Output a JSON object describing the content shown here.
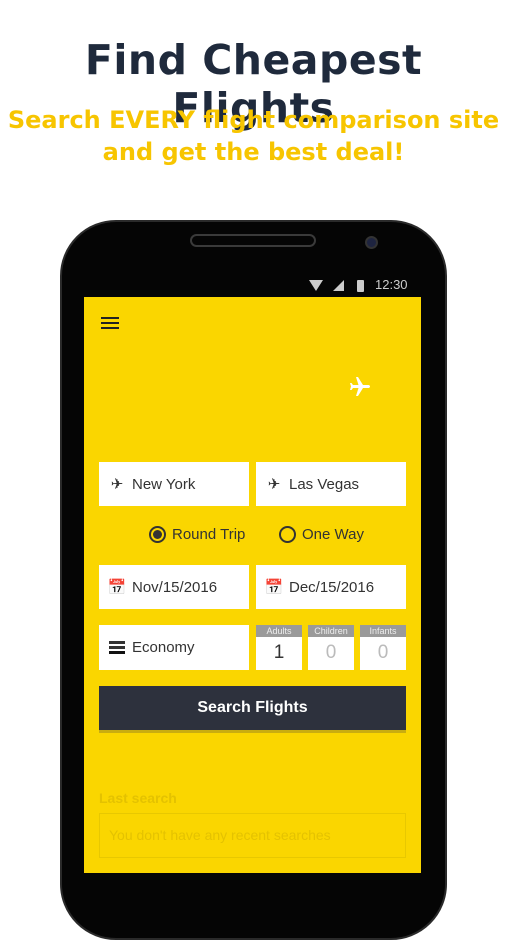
{
  "headline": "Find Cheapest Flights",
  "subline1": "Search EVERY flight comparison site",
  "subline2": "and get the best deal!",
  "status": {
    "time": "12:30"
  },
  "form": {
    "from": "New York",
    "to": "Las Vegas",
    "trip_types": [
      {
        "label": "Round Trip",
        "selected": true
      },
      {
        "label": "One Way",
        "selected": false
      }
    ],
    "depart": "Nov/15/2016",
    "return": "Dec/15/2016",
    "cabin": "Economy",
    "passengers": [
      {
        "label": "Adults",
        "value": "1"
      },
      {
        "label": "Children",
        "value": "0"
      },
      {
        "label": "Infants",
        "value": "0"
      }
    ],
    "search_label": "Search Flights"
  },
  "last_search": {
    "title": "Last search",
    "empty": "You don't have any recent searches"
  },
  "colors": {
    "accent": "#fad600",
    "button": "#2d313d",
    "headline": "#1f2a3c",
    "subline": "#f7c500"
  }
}
